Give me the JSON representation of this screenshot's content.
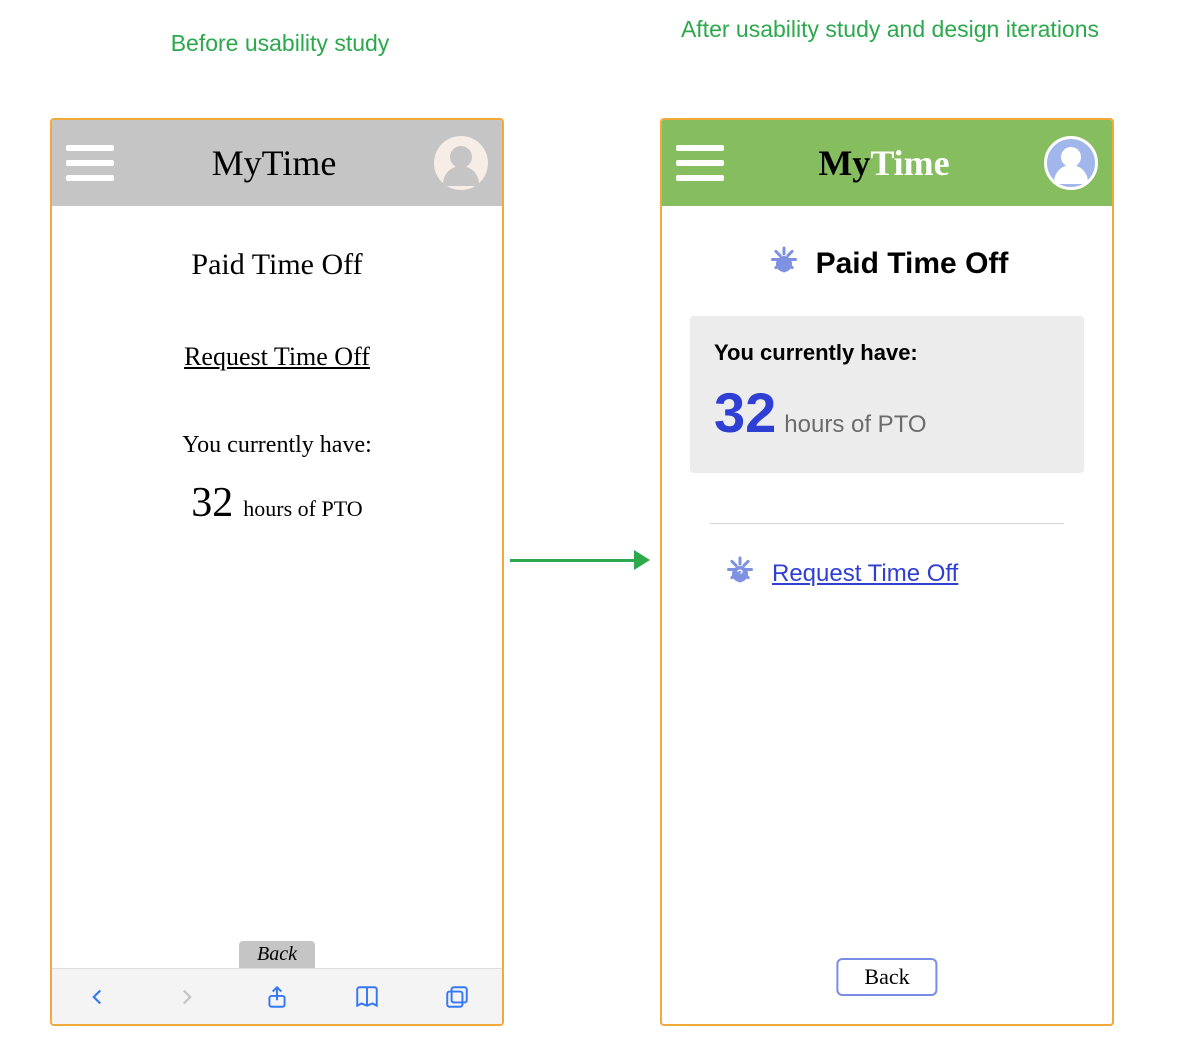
{
  "labels": {
    "before": "Before usability study",
    "after": "After usability study and design iterations"
  },
  "brand": {
    "full": "MyTime",
    "part1": "My",
    "part2": "Time"
  },
  "before": {
    "page_title": "Paid Time Off",
    "request_link": "Request Time Off",
    "balance_intro": "You currently have:",
    "balance_value": "32",
    "balance_unit": "hours of PTO",
    "back_label": "Back"
  },
  "after": {
    "page_title": "Paid Time Off",
    "balance_intro": "You currently have:",
    "balance_value": "32",
    "balance_unit": "hours of PTO",
    "request_link": "Request Time Off",
    "back_label": "Back"
  },
  "colors": {
    "green_label": "#2ca84d",
    "green_header": "#86bd5f",
    "blue_accent": "#2f3fd3",
    "blue_avatar": "#a1b7ec",
    "frame": "#f2a93b"
  }
}
